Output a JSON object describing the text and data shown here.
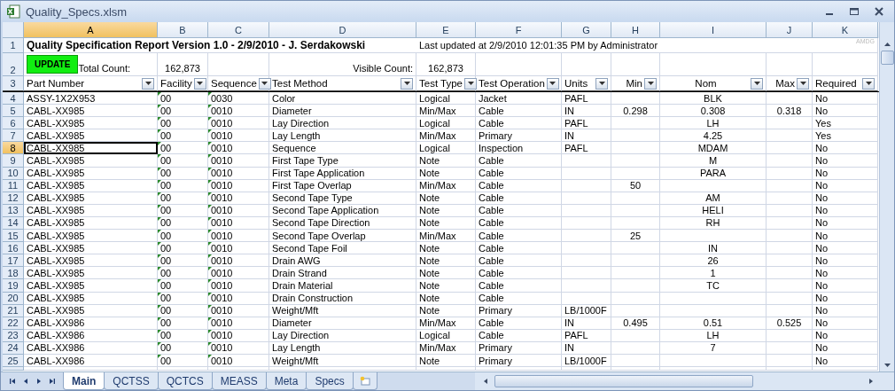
{
  "window": {
    "title": "Quality_Specs.xlsm"
  },
  "column_letters": [
    {
      "label": "A",
      "selected": true
    },
    {
      "label": "B",
      "selected": false
    },
    {
      "label": "C",
      "selected": false
    },
    {
      "label": "D",
      "selected": false
    },
    {
      "label": "E",
      "selected": false
    },
    {
      "label": "F",
      "selected": false
    },
    {
      "label": "G",
      "selected": false
    },
    {
      "label": "H",
      "selected": false
    },
    {
      "label": "I",
      "selected": false
    },
    {
      "label": "J",
      "selected": false
    },
    {
      "label": "K",
      "selected": false
    }
  ],
  "report": {
    "row_1": "1",
    "title": "Quality Specification Report Version 1.0 - 2/9/2010 - J. Serdakowski",
    "last_updated": "Last updated at 2/9/2010 12:01:35 PM by Administrator",
    "corner_note": "AMDG",
    "row_2": "2",
    "update_button": "UPDATE",
    "total_label": "Total Count:",
    "total_value": "162,873",
    "visible_label": "Visible Count:",
    "visible_value": "162,873"
  },
  "header_row": {
    "row": "3",
    "columns": [
      {
        "label": "Part Number",
        "flagged": false
      },
      {
        "label": "Facility",
        "flagged": true
      },
      {
        "label": "Sequence",
        "flagged": true
      },
      {
        "label": "Test Method",
        "flagged": false
      },
      {
        "label": "Test Type",
        "flagged": false
      },
      {
        "label": "Test Operation",
        "flagged": false
      },
      {
        "label": "Units",
        "flagged": false
      },
      {
        "label": "Min",
        "flagged": false
      },
      {
        "label": "Nom",
        "flagged": false
      },
      {
        "label": "Max",
        "flagged": false
      },
      {
        "label": "Required",
        "flagged": false
      }
    ]
  },
  "rows": [
    {
      "row": "4",
      "selected": false,
      "cells": [
        "ASSY-1X2X953",
        "00",
        "0030",
        "Color",
        "Logical",
        "Jacket",
        "PAFL",
        null,
        "BLK",
        null,
        "No"
      ]
    },
    {
      "row": "5",
      "selected": false,
      "cells": [
        "CABL-XX985",
        "00",
        "0010",
        "Diameter",
        "Min/Max",
        "Cable",
        "IN",
        "0.298",
        "0.308",
        "0.318",
        "No"
      ]
    },
    {
      "row": "6",
      "selected": false,
      "cells": [
        "CABL-XX985",
        "00",
        "0010",
        "Lay Direction",
        "Logical",
        "Cable",
        "PAFL",
        null,
        "LH",
        null,
        "Yes"
      ]
    },
    {
      "row": "7",
      "selected": false,
      "cells": [
        "CABL-XX985",
        "00",
        "0010",
        "Lay Length",
        "Min/Max",
        "Primary",
        "IN",
        null,
        "4.25",
        null,
        "Yes"
      ]
    },
    {
      "row": "8",
      "selected": true,
      "cells": [
        "CABL-XX985",
        "00",
        "0010",
        "Sequence",
        "Logical",
        "Inspection",
        "PAFL",
        null,
        "MDAM",
        null,
        "No"
      ]
    },
    {
      "row": "9",
      "selected": false,
      "cells": [
        "CABL-XX985",
        "00",
        "0010",
        "First Tape Type",
        "Note",
        "Cable",
        null,
        null,
        "M",
        null,
        "No"
      ]
    },
    {
      "row": "10",
      "selected": false,
      "cells": [
        "CABL-XX985",
        "00",
        "0010",
        "First Tape Application",
        "Note",
        "Cable",
        null,
        null,
        "PARA",
        null,
        "No"
      ]
    },
    {
      "row": "11",
      "selected": false,
      "cells": [
        "CABL-XX985",
        "00",
        "0010",
        "First Tape Overlap",
        "Min/Max",
        "Cable",
        null,
        "50",
        null,
        null,
        "No"
      ]
    },
    {
      "row": "12",
      "selected": false,
      "cells": [
        "CABL-XX985",
        "00",
        "0010",
        "Second Tape Type",
        "Note",
        "Cable",
        null,
        null,
        "AM",
        null,
        "No"
      ]
    },
    {
      "row": "13",
      "selected": false,
      "cells": [
        "CABL-XX985",
        "00",
        "0010",
        "Second Tape Application",
        "Note",
        "Cable",
        null,
        null,
        "HELI",
        null,
        "No"
      ]
    },
    {
      "row": "14",
      "selected": false,
      "cells": [
        "CABL-XX985",
        "00",
        "0010",
        "Second Tape Direction",
        "Note",
        "Cable",
        null,
        null,
        "RH",
        null,
        "No"
      ]
    },
    {
      "row": "15",
      "selected": false,
      "cells": [
        "CABL-XX985",
        "00",
        "0010",
        "Second Tape Overlap",
        "Min/Max",
        "Cable",
        null,
        "25",
        null,
        null,
        "No"
      ]
    },
    {
      "row": "16",
      "selected": false,
      "cells": [
        "CABL-XX985",
        "00",
        "0010",
        "Second Tape Foil",
        "Note",
        "Cable",
        null,
        null,
        "IN",
        null,
        "No"
      ]
    },
    {
      "row": "17",
      "selected": false,
      "cells": [
        "CABL-XX985",
        "00",
        "0010",
        "Drain AWG",
        "Note",
        "Cable",
        null,
        null,
        "26",
        null,
        "No"
      ]
    },
    {
      "row": "18",
      "selected": false,
      "cells": [
        "CABL-XX985",
        "00",
        "0010",
        "Drain Strand",
        "Note",
        "Cable",
        null,
        null,
        "1",
        null,
        "No"
      ]
    },
    {
      "row": "19",
      "selected": false,
      "cells": [
        "CABL-XX985",
        "00",
        "0010",
        "Drain Material",
        "Note",
        "Cable",
        null,
        null,
        "TC",
        null,
        "No"
      ]
    },
    {
      "row": "20",
      "selected": false,
      "cells": [
        "CABL-XX985",
        "00",
        "0010",
        "Drain Construction",
        "Note",
        "Cable",
        null,
        null,
        null,
        null,
        "No"
      ]
    },
    {
      "row": "21",
      "selected": false,
      "cells": [
        "CABL-XX985",
        "00",
        "0010",
        "Weight/Mft",
        "Note",
        "Primary",
        "LB/1000F",
        null,
        null,
        null,
        "No"
      ]
    },
    {
      "row": "22",
      "selected": false,
      "cells": [
        "CABL-XX986",
        "00",
        "0010",
        "Diameter",
        "Min/Max",
        "Cable",
        "IN",
        "0.495",
        "0.51",
        "0.525",
        "No"
      ]
    },
    {
      "row": "23",
      "selected": false,
      "cells": [
        "CABL-XX986",
        "00",
        "0010",
        "Lay Direction",
        "Logical",
        "Cable",
        "PAFL",
        null,
        "LH",
        null,
        "No"
      ]
    },
    {
      "row": "24",
      "selected": false,
      "cells": [
        "CABL-XX986",
        "00",
        "0010",
        "Lay Length",
        "Min/Max",
        "Primary",
        "IN",
        null,
        "7",
        null,
        "No"
      ]
    },
    {
      "row": "25",
      "selected": false,
      "cells": [
        "CABL-XX986",
        "00",
        "0010",
        "Weight/Mft",
        "Note",
        "Primary",
        "LB/1000F",
        null,
        null,
        null,
        "No"
      ]
    }
  ],
  "sheet_tabs": [
    {
      "label": "Main",
      "selected": true
    },
    {
      "label": "QCTSS",
      "selected": false
    },
    {
      "label": "QCTCS",
      "selected": false
    },
    {
      "label": "MEASS",
      "selected": false
    },
    {
      "label": "Meta",
      "selected": false
    },
    {
      "label": "Specs",
      "selected": false
    }
  ]
}
